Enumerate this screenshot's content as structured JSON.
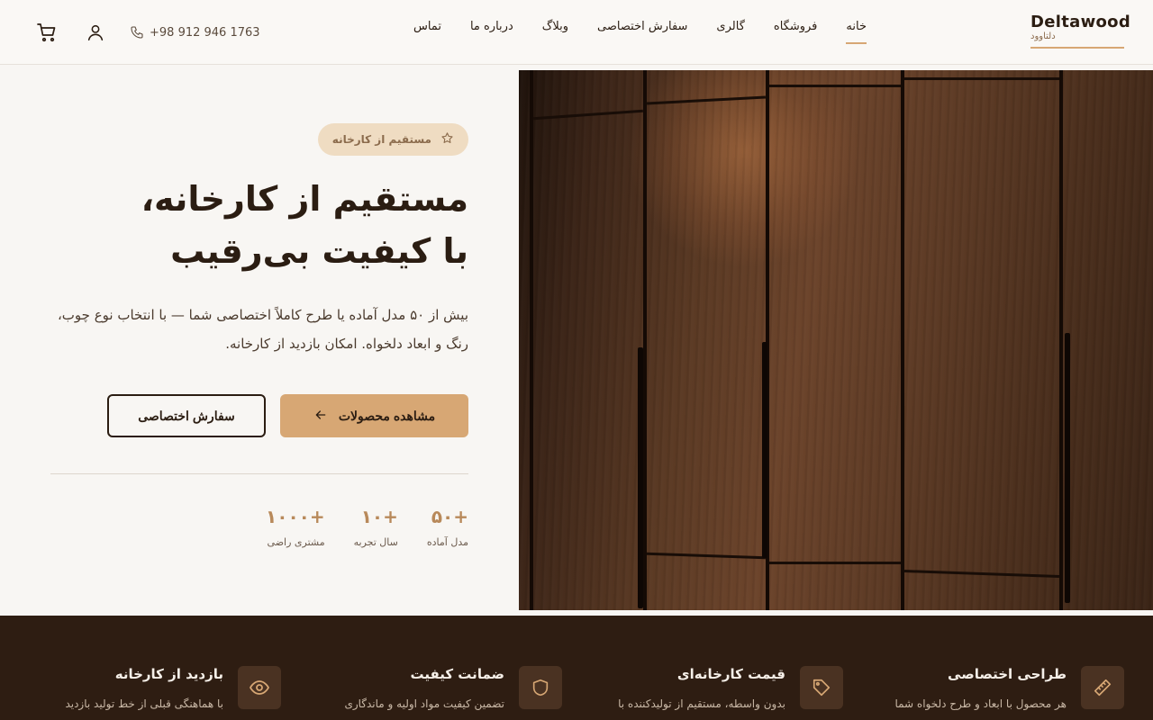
{
  "brand": {
    "name_en": "Deltawood",
    "name_fa": "دلتاوود"
  },
  "nav": [
    {
      "label": "خانه",
      "active": true
    },
    {
      "label": "فروشگاه",
      "active": false
    },
    {
      "label": "گالری",
      "active": false
    },
    {
      "label": "سفارش اختصاصی",
      "active": false
    },
    {
      "label": "وبلاگ",
      "active": false
    },
    {
      "label": "درباره ما",
      "active": false
    },
    {
      "label": "تماس",
      "active": false
    }
  ],
  "contact": {
    "phone": "+98 912 946 1763"
  },
  "hero": {
    "badge": "مستقیم از کارخانه",
    "title_line1": "مستقیم از کارخانه،",
    "title_line2": "با کیفیت بی‌رقیب",
    "description": "بیش از ۵۰ مدل آماده یا طرح کاملاً اختصاصی شما — با انتخاب نوع چوب، رنگ و ابعاد دلخواه. امکان بازدید از کارخانه.",
    "primary_button": "مشاهده محصولات",
    "secondary_button": "سفارش اختصاصی",
    "stats": [
      {
        "value": "+۵۰",
        "label": "مدل آماده"
      },
      {
        "value": "+۱۰",
        "label": "سال تجربه"
      },
      {
        "value": "+۱۰۰۰",
        "label": "مشتری راضی"
      }
    ]
  },
  "features": [
    {
      "title": "طراحی اختصاصی",
      "desc": "هر محصول با ابعاد و طرح دلخواه شما",
      "icon": "ruler-icon"
    },
    {
      "title": "قیمت کارخانه‌ای",
      "desc": "بدون واسطه، مستقیم از تولیدکننده با",
      "icon": "tag-icon"
    },
    {
      "title": "ضمانت کیفیت",
      "desc": "تضمین کیفیت مواد اولیه و ماندگاری",
      "icon": "shield-icon"
    },
    {
      "title": "بازدید از کارخانه",
      "desc": "با هماهنگی قبلی از خط تولید بازدید",
      "icon": "eye-icon"
    }
  ],
  "colors": {
    "accent": "#d7a774",
    "dark": "#2e1d12",
    "text": "#2b1d12",
    "bg": "#f8f6f3"
  }
}
